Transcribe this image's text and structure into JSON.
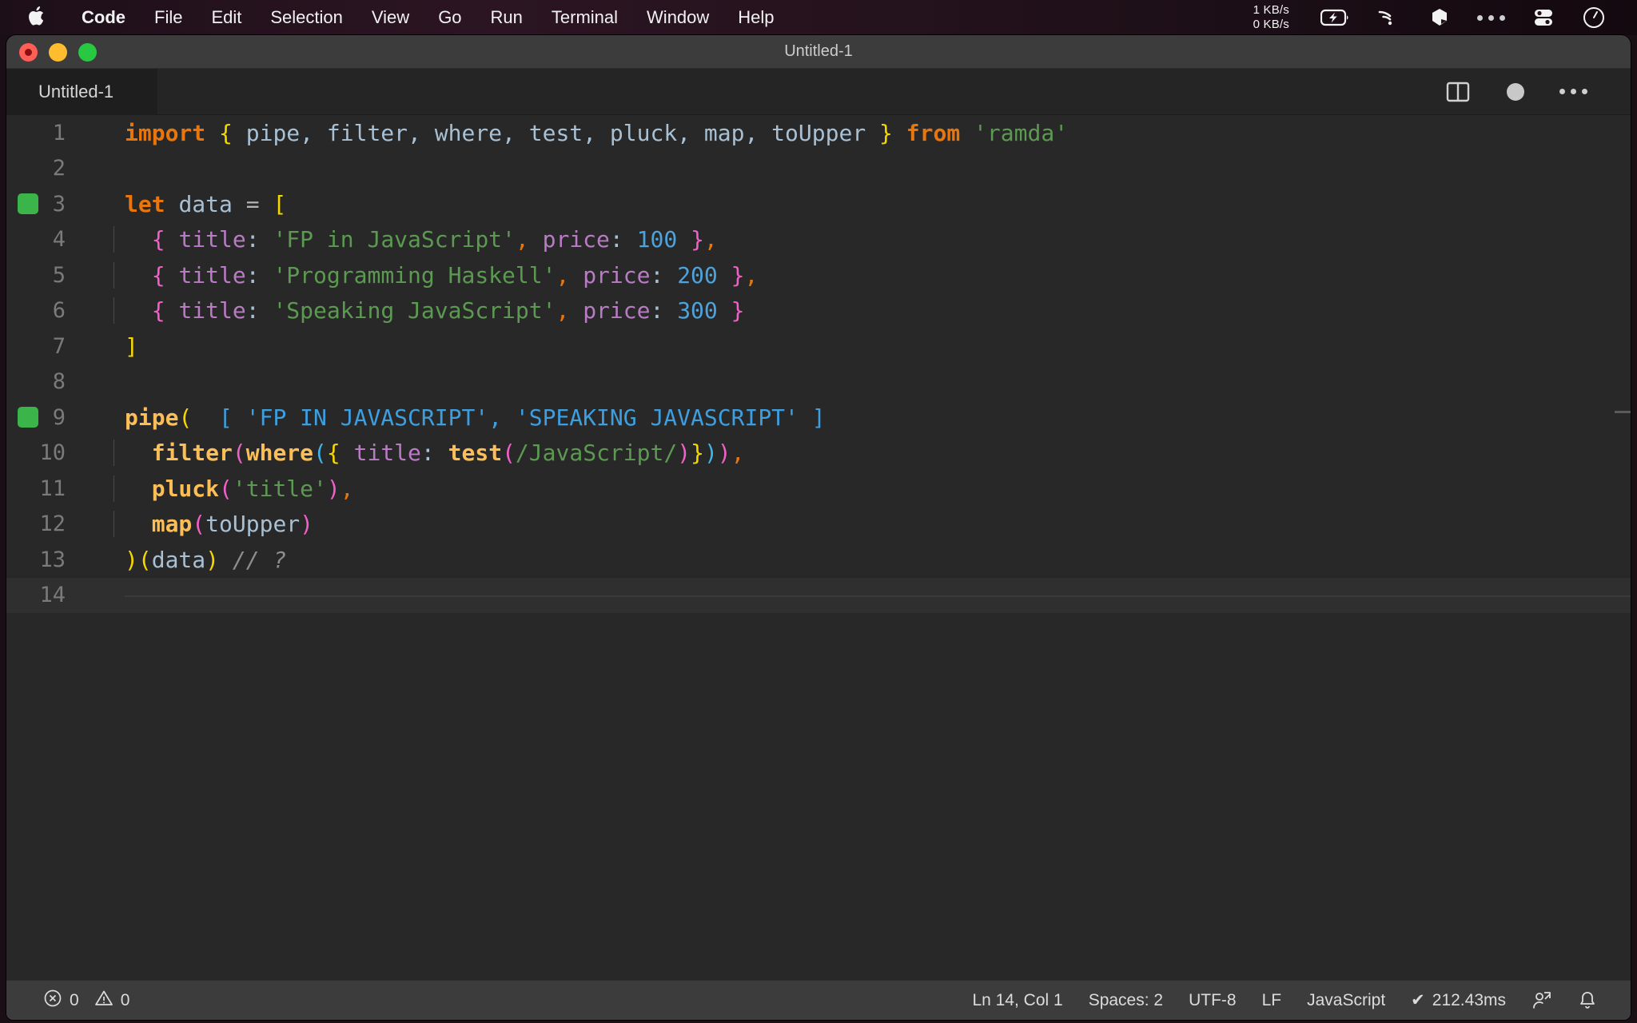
{
  "menubar": {
    "apple_icon": "apple-logo-icon",
    "items": [
      {
        "label": "Code",
        "bold": true
      },
      {
        "label": "File",
        "bold": false
      },
      {
        "label": "Edit",
        "bold": false
      },
      {
        "label": "Selection",
        "bold": false
      },
      {
        "label": "View",
        "bold": false
      },
      {
        "label": "Go",
        "bold": false
      },
      {
        "label": "Run",
        "bold": false
      },
      {
        "label": "Terminal",
        "bold": false
      },
      {
        "label": "Window",
        "bold": false
      },
      {
        "label": "Help",
        "bold": false
      }
    ],
    "status": {
      "net_down": "1 KB/s",
      "net_up": "0 KB/s",
      "icons": [
        "battery-charging-icon",
        "wifi-icon",
        "dropbox-icon",
        "more-menus-icon",
        "control-center-icon",
        "siri-icon"
      ]
    }
  },
  "window": {
    "title": "Untitled-1",
    "traffic_lights": [
      "close-button",
      "minimize-button",
      "maximize-button"
    ]
  },
  "tabbar": {
    "tab_label": "Untitled-1",
    "actions": [
      "split-editor-icon",
      "unsaved-dot-icon",
      "more-actions-icon"
    ]
  },
  "editor": {
    "lines": [
      {
        "n": "1",
        "breakpoint": false,
        "indent": 0
      },
      {
        "n": "2",
        "breakpoint": false,
        "indent": 0
      },
      {
        "n": "3",
        "breakpoint": true,
        "indent": 0
      },
      {
        "n": "4",
        "breakpoint": false,
        "indent": 1
      },
      {
        "n": "5",
        "breakpoint": false,
        "indent": 1
      },
      {
        "n": "6",
        "breakpoint": false,
        "indent": 1
      },
      {
        "n": "7",
        "breakpoint": false,
        "indent": 0
      },
      {
        "n": "8",
        "breakpoint": false,
        "indent": 0
      },
      {
        "n": "9",
        "breakpoint": true,
        "indent": 0
      },
      {
        "n": "10",
        "breakpoint": false,
        "indent": 1
      },
      {
        "n": "11",
        "breakpoint": false,
        "indent": 1
      },
      {
        "n": "12",
        "breakpoint": false,
        "indent": 1
      },
      {
        "n": "13",
        "breakpoint": false,
        "indent": 0
      },
      {
        "n": "14",
        "breakpoint": false,
        "indent": 0
      }
    ],
    "code": {
      "l1": {
        "kw_import": "import",
        "br_open": "{",
        "names": " pipe, filter, where, test, pluck, map, toUpper ",
        "br_close": "}",
        "kw_from": "from",
        "module": "'ramda'"
      },
      "l3": {
        "kw": "let",
        "name": "data",
        "op": "=",
        "bracket": "["
      },
      "l4": {
        "brace_open": "{",
        "prop1": "title",
        "colon": ":",
        "str": "'FP in JavaScript'",
        "comma": ",",
        "prop2": "price",
        "num": "100",
        "brace_close": "}",
        "trail": ","
      },
      "l5": {
        "brace_open": "{",
        "prop1": "title",
        "colon": ":",
        "str": "'Programming Haskell'",
        "comma": ",",
        "prop2": "price",
        "num": "200",
        "brace_close": "}",
        "trail": ","
      },
      "l6": {
        "brace_open": "{",
        "prop1": "title",
        "colon": ":",
        "str": "'Speaking JavaScript'",
        "comma": ",",
        "prop2": "price",
        "num": "300",
        "brace_close": "}",
        "trail": ""
      },
      "l7": {
        "bracket": "]"
      },
      "l9": {
        "fn": "pipe",
        "paren": "(",
        "result": "[ 'FP IN JAVASCRIPT', 'SPEAKING JAVASCRIPT' ]"
      },
      "l10": {
        "fn1": "filter",
        "p1": "(",
        "fn2": "where",
        "p2": "(",
        "brace": "{",
        "prop": "title",
        "colon": ":",
        "fn3": "test",
        "p3": "(",
        "regex": "/JavaScript/",
        "p3c": ")",
        "bracec": "}",
        "p2c": ")",
        "p1c": ")",
        "comma": ","
      },
      "l11": {
        "fn": "pluck",
        "p": "(",
        "str": "'title'",
        "pc": ")",
        "comma": ","
      },
      "l12": {
        "fn": "map",
        "p": "(",
        "arg": "toUpper",
        "pc": ")"
      },
      "l13": {
        "pc": ")",
        "po": "(",
        "arg": "data",
        "pcl": ")",
        "comment": "// ?"
      }
    }
  },
  "statusbar": {
    "errors": "0",
    "warnings": "0",
    "cursor": "Ln 14, Col 1",
    "spaces": "Spaces: 2",
    "encoding": "UTF-8",
    "eol": "LF",
    "language": "JavaScript",
    "quokka_time": "212.43ms",
    "quokka_check": "✔",
    "right_icons": [
      "live-share-icon",
      "notifications-bell-icon"
    ]
  }
}
